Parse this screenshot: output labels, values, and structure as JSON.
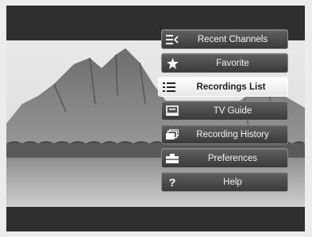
{
  "menu": {
    "items": [
      {
        "label": "Recent Channels",
        "icon": "recent-channels-icon",
        "selected": false
      },
      {
        "label": "Favorite",
        "icon": "star-icon",
        "selected": false
      },
      {
        "label": "Recordings List",
        "icon": "list-icon",
        "selected": true
      },
      {
        "label": "TV Guide",
        "icon": "tv-guide-icon",
        "selected": false
      },
      {
        "label": "Recording History",
        "icon": "history-icon",
        "selected": false
      },
      {
        "label": "Preferences",
        "icon": "preferences-icon",
        "selected": false
      },
      {
        "label": "Help",
        "icon": "question-icon",
        "selected": false
      }
    ]
  },
  "colors": {
    "screen_bg": "#2f2f2f",
    "item_bg": "#505050",
    "item_selected_bg": "#ffffff"
  }
}
